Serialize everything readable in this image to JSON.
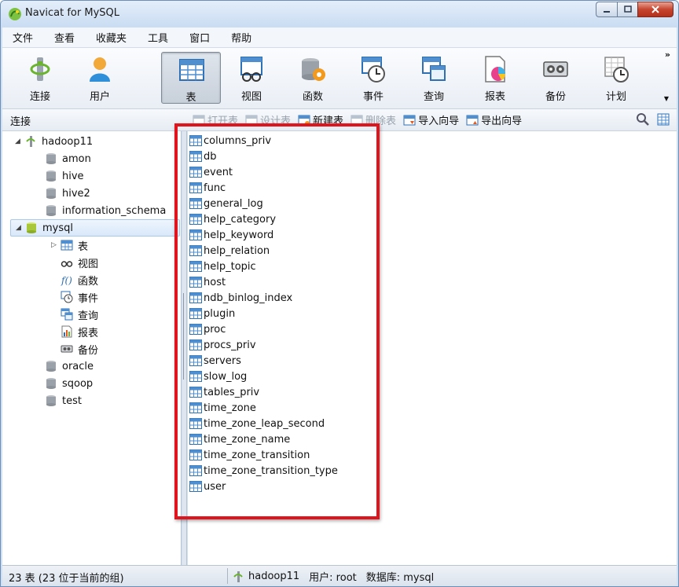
{
  "window": {
    "title": "Navicat for MySQL"
  },
  "menu": [
    "文件",
    "查看",
    "收藏夹",
    "工具",
    "窗口",
    "帮助"
  ],
  "toolbar": {
    "tools": [
      {
        "label": "连接",
        "icon": "connection-icon"
      },
      {
        "label": "用户",
        "icon": "user-icon"
      },
      {
        "label": "表",
        "icon": "table-icon",
        "active": true
      },
      {
        "label": "视图",
        "icon": "view-icon"
      },
      {
        "label": "函数",
        "icon": "function-icon"
      },
      {
        "label": "事件",
        "icon": "event-icon"
      },
      {
        "label": "查询",
        "icon": "query-icon"
      },
      {
        "label": "报表",
        "icon": "report-icon"
      },
      {
        "label": "备份",
        "icon": "backup-icon"
      },
      {
        "label": "计划",
        "icon": "schedule-icon"
      }
    ],
    "more": "»"
  },
  "subbar": {
    "connection_label": "连接",
    "actions": [
      {
        "label": "打开表",
        "enabled": false
      },
      {
        "label": "设计表",
        "enabled": false
      },
      {
        "label": "新建表",
        "enabled": true
      },
      {
        "label": "删除表",
        "enabled": false
      },
      {
        "label": "导入向导",
        "enabled": true
      },
      {
        "label": "导出向导",
        "enabled": true
      }
    ]
  },
  "tree": {
    "connection": "hadoop11",
    "databases": [
      "amon",
      "hive",
      "hive2",
      "information_schema",
      "mysql",
      "oracle",
      "sqoop",
      "test"
    ],
    "selected_database": "mysql",
    "mysql_children": [
      {
        "label": "表",
        "icon": "table-icon"
      },
      {
        "label": "视图",
        "icon": "view-icon"
      },
      {
        "label": "函数",
        "icon": "function-icon"
      },
      {
        "label": "事件",
        "icon": "event-icon"
      },
      {
        "label": "查询",
        "icon": "query-icon"
      },
      {
        "label": "报表",
        "icon": "report-icon"
      },
      {
        "label": "备份",
        "icon": "backup-icon"
      }
    ]
  },
  "tables": [
    "columns_priv",
    "db",
    "event",
    "func",
    "general_log",
    "help_category",
    "help_keyword",
    "help_relation",
    "help_topic",
    "host",
    "ndb_binlog_index",
    "plugin",
    "proc",
    "procs_priv",
    "servers",
    "slow_log",
    "tables_priv",
    "time_zone",
    "time_zone_leap_second",
    "time_zone_name",
    "time_zone_transition",
    "time_zone_transition_type",
    "user"
  ],
  "status": {
    "count_text": "23 表 (23 位于当前的组)",
    "connection": "hadoop11",
    "user": "用户: root",
    "database": "数据库: mysql"
  },
  "colors": {
    "highlight": "#e0141c",
    "selection": "#d9e8fa"
  }
}
